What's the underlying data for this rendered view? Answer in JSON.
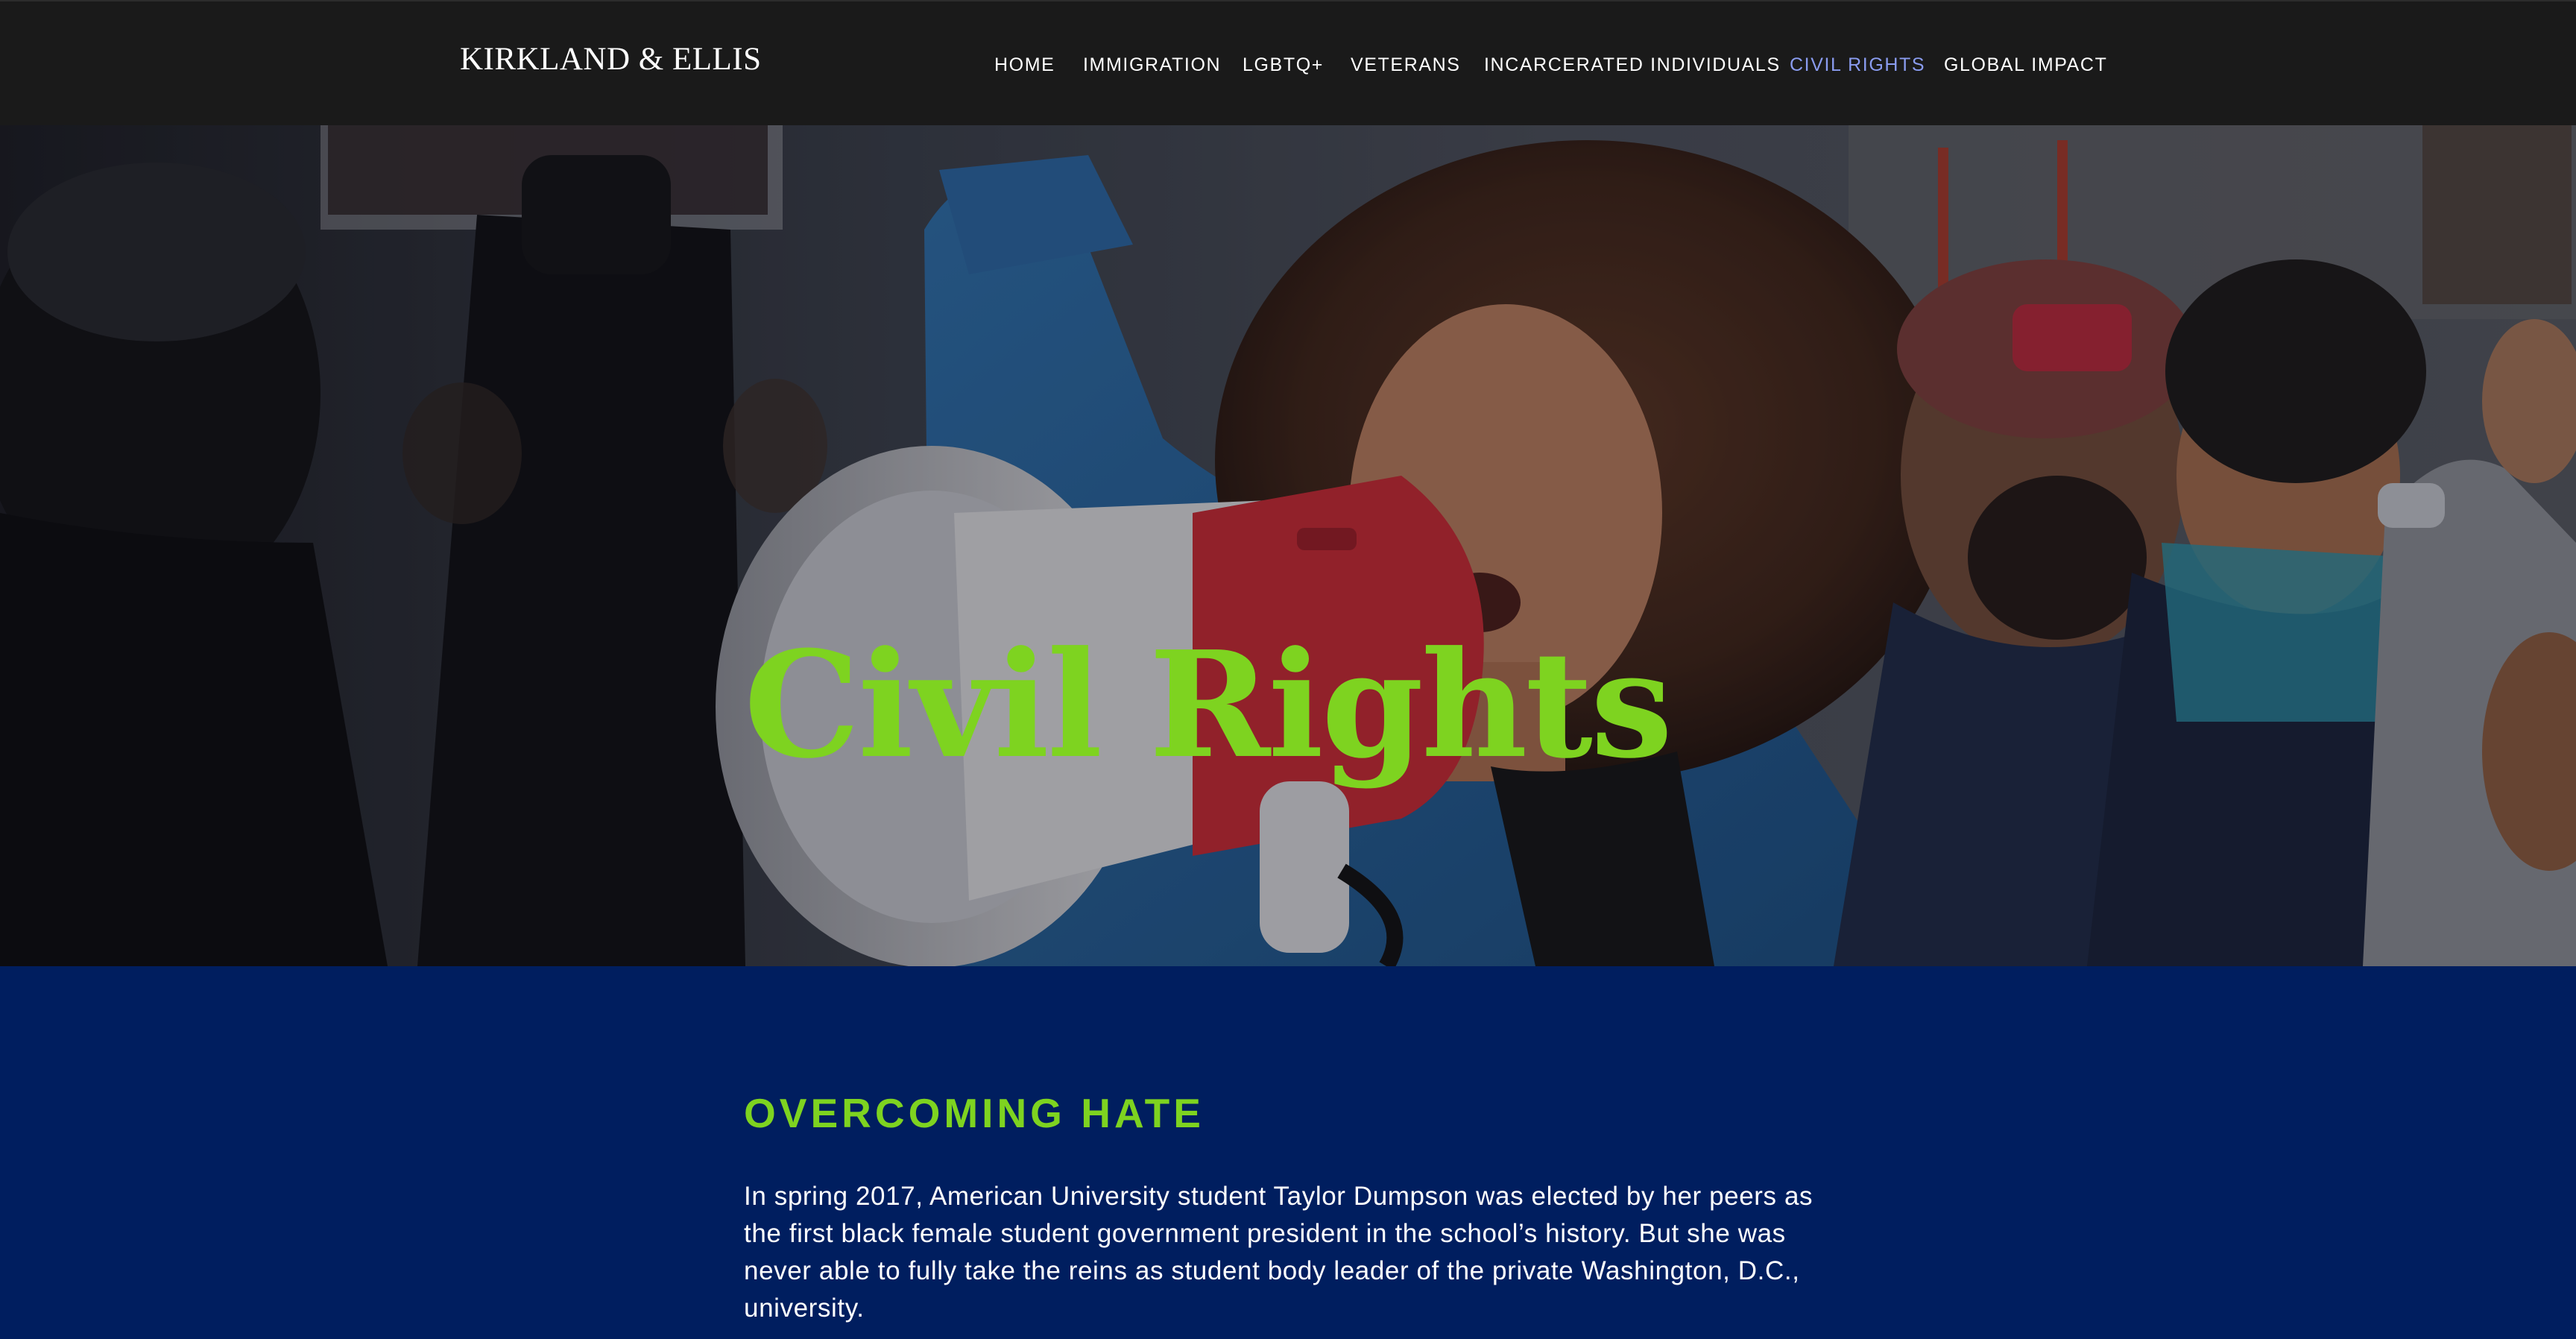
{
  "header": {
    "logo_text": "KIRKLAND & ELLIS",
    "nav": [
      {
        "label": "HOME",
        "active": false
      },
      {
        "label": "IMMIGRATION",
        "active": false
      },
      {
        "label": "LGBTQ+",
        "active": false
      },
      {
        "label": "VETERANS",
        "active": false
      },
      {
        "label": "INCARCERATED INDIVIDUALS",
        "active": false
      },
      {
        "label": "CIVIL RIGHTS",
        "active": true
      },
      {
        "label": "GLOBAL IMPACT",
        "active": false
      }
    ],
    "active_color": "#8a9cf0"
  },
  "hero": {
    "title": "Civil Rights",
    "image": "protest-megaphone-photo",
    "title_color": "#7ed320"
  },
  "section": {
    "heading": "OVERCOMING HATE",
    "body": "In spring 2017, American University student Taylor Dumpson was elected by her peers as the first black female student government president in the school’s history. But she was never able to fully take the reins as student body leader of the private Washington, D.C., university.",
    "background": "#001e5f",
    "heading_color": "#7ed320"
  }
}
